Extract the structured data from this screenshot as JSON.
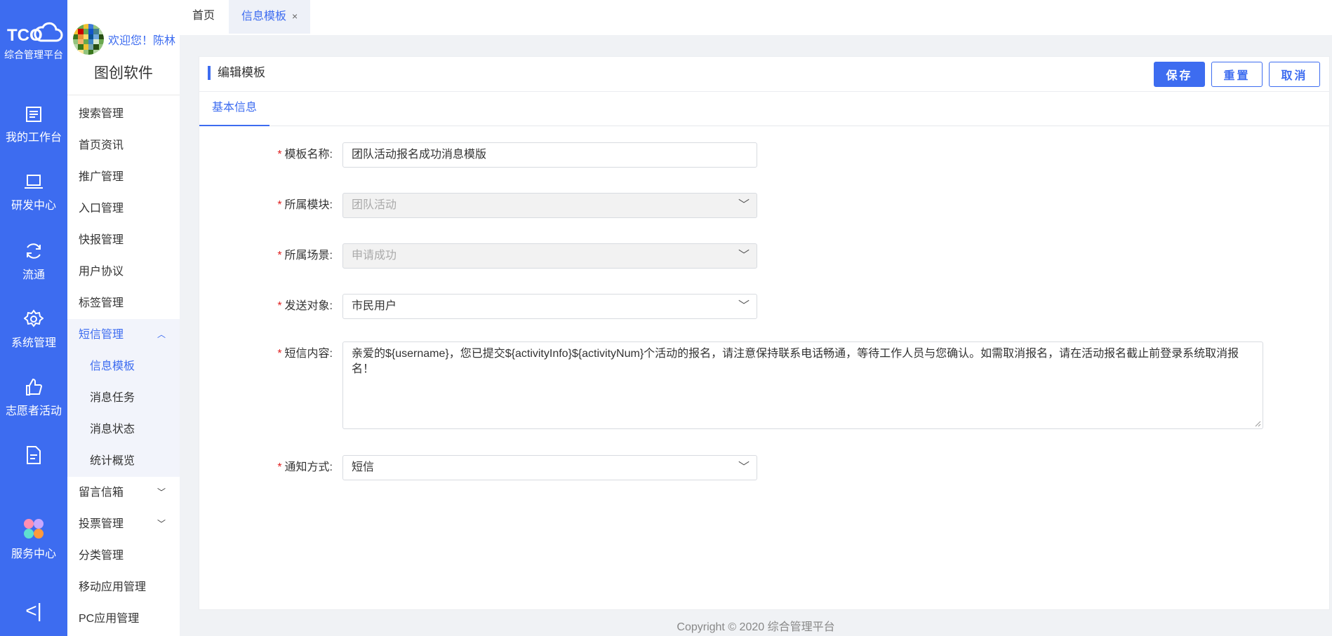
{
  "rail": {
    "logo_text": "TCO",
    "logo_subtitle": "综合管理平台",
    "items": [
      {
        "label": "我的工作台",
        "icon": "list-icon"
      },
      {
        "label": "研发中心",
        "icon": "laptop-icon"
      },
      {
        "label": "流通",
        "icon": "refresh-icon"
      },
      {
        "label": "系统管理",
        "icon": "gear-icon"
      },
      {
        "label": "志愿者活动",
        "icon": "thumbs-up-icon"
      },
      {
        "label": "",
        "icon": "document-icon"
      },
      {
        "label": "服务中心",
        "icon": "apps-icon"
      }
    ],
    "collapse_glyph": "<|"
  },
  "sidebar": {
    "welcome": "欢迎您！陈林",
    "company": "图创软件",
    "menu": [
      "搜索管理",
      "首页资讯",
      "推广管理",
      "入口管理",
      "快报管理",
      "用户协议",
      "标签管理"
    ],
    "sms_menu": "短信管理",
    "sms_sub": [
      "信息模板",
      "消息任务",
      "消息状态",
      "统计概览"
    ],
    "menu_after": [
      {
        "label": "留言信箱",
        "expandable": true
      },
      {
        "label": "投票管理",
        "expandable": true
      },
      {
        "label": "分类管理",
        "expandable": false
      },
      {
        "label": "移动应用管理",
        "expandable": false
      },
      {
        "label": "PC应用管理",
        "expandable": false
      }
    ]
  },
  "tabs": {
    "home": "首页",
    "active": "信息模板",
    "close": "×"
  },
  "card": {
    "title": "编辑模板",
    "save": "保存",
    "reset": "重置",
    "cancel": "取消",
    "subtab": "基本信息"
  },
  "form": {
    "name_label": "模板名称:",
    "name_value": "团队活动报名成功消息模版",
    "module_label": "所属模块:",
    "module_value": "团队活动",
    "scene_label": "所属场景:",
    "scene_value": "申请成功",
    "target_label": "发送对象:",
    "target_value": "市民用户",
    "content_label": "短信内容:",
    "content_value": "亲爱的${username}，您已提交${activityInfo}${activityNum}个活动的报名，请注意保持联系电话畅通，等待工作人员与您确认。如需取消报名，请在活动报名截止前登录系统取消报名！",
    "notify_label": "通知方式:",
    "notify_value": "短信"
  },
  "footer": "Copyright © 2020 综合管理平台",
  "colors": {
    "accent": "#3d6cf0",
    "required": "#e02020"
  }
}
